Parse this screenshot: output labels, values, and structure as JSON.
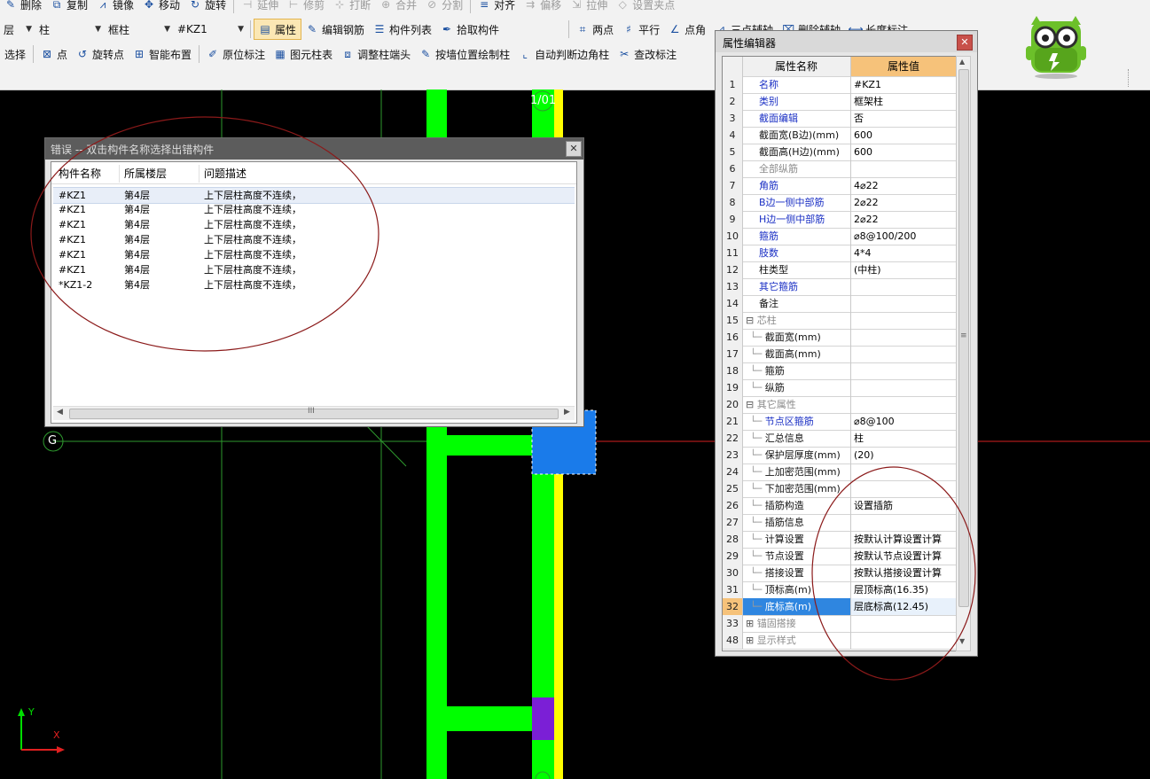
{
  "toolbar": {
    "row1": [
      {
        "label": "删除",
        "icon": "delete-icon",
        "dim": false
      },
      {
        "label": "复制",
        "icon": "copy-icon",
        "dim": false
      },
      {
        "label": "镜像",
        "icon": "mirror-icon",
        "dim": false
      },
      {
        "label": "移动",
        "icon": "move-icon",
        "dim": false
      },
      {
        "label": "旋转",
        "icon": "rotate-icon",
        "dim": false
      },
      {
        "label": "延伸",
        "icon": "extend-icon",
        "dim": true
      },
      {
        "label": "修剪",
        "icon": "trim-icon",
        "dim": true
      },
      {
        "label": "打断",
        "icon": "break-icon",
        "dim": true
      },
      {
        "label": "合并",
        "icon": "merge-icon",
        "dim": true
      },
      {
        "label": "分割",
        "icon": "split-icon",
        "dim": true
      },
      {
        "label": "对齐",
        "icon": "align-icon",
        "dim": false
      },
      {
        "label": "偏移",
        "icon": "offset-icon",
        "dim": true
      },
      {
        "label": "拉伸",
        "icon": "stretch-icon",
        "dim": true
      },
      {
        "label": "设置夹点",
        "icon": "grip-icon",
        "dim": true
      }
    ],
    "row2_selects": [
      "层",
      "柱",
      "框柱",
      "#KZ1"
    ],
    "row2_buttons": [
      {
        "label": "属性",
        "icon": "properties-icon",
        "active": true
      },
      {
        "label": "编辑钢筋",
        "icon": "edit-rebar-icon",
        "active": false
      },
      {
        "label": "构件列表",
        "icon": "component-list-icon",
        "active": false
      },
      {
        "label": "拾取构件",
        "icon": "pick-component-icon",
        "active": false
      }
    ],
    "row2_right": [
      {
        "label": "两点",
        "icon": "two-point-icon"
      },
      {
        "label": "平行",
        "icon": "parallel-icon"
      },
      {
        "label": "点角",
        "icon": "point-angle-icon"
      },
      {
        "label": "三点辅轴",
        "icon": "three-point-axis-icon"
      },
      {
        "label": "删除辅轴",
        "icon": "delete-axis-icon"
      },
      {
        "label": "长度标注",
        "icon": "length-dim-icon"
      }
    ],
    "row3": [
      {
        "label": "选择",
        "icon": "select-icon"
      },
      {
        "label": "点",
        "icon": "point-icon"
      },
      {
        "label": "旋转点",
        "icon": "rotate-point-icon"
      },
      {
        "label": "智能布置",
        "icon": "smart-layout-icon"
      },
      {
        "label": "原位标注",
        "icon": "in-place-mark-icon"
      },
      {
        "label": "图元柱表",
        "icon": "column-table-icon"
      },
      {
        "label": "调整柱端头",
        "icon": "adjust-column-end-icon"
      },
      {
        "label": "按墙位置绘制柱",
        "icon": "draw-by-wall-icon"
      },
      {
        "label": "自动判断边角柱",
        "icon": "auto-corner-icon"
      },
      {
        "label": "查改标注",
        "icon": "check-mark-icon"
      }
    ]
  },
  "canvas": {
    "axis_label_g": "G",
    "axis_label_top": "1/01",
    "ucs_y": "Y",
    "ucs_x": "X"
  },
  "error_dialog": {
    "title": "错误 -- 双击构件名称选择出错构件",
    "columns": [
      "构件名称",
      "所属楼层",
      "问题描述"
    ],
    "rows": [
      [
        "#KZ1",
        "第4层",
        "上下层柱高度不连续，"
      ],
      [
        "#KZ1",
        "第4层",
        "上下层柱高度不连续，"
      ],
      [
        "#KZ1",
        "第4层",
        "上下层柱高度不连续，"
      ],
      [
        "#KZ1",
        "第4层",
        "上下层柱高度不连续，"
      ],
      [
        "#KZ1",
        "第4层",
        "上下层柱高度不连续，"
      ],
      [
        "#KZ1",
        "第4层",
        "上下层柱高度不连续，"
      ],
      [
        "*KZ1-2",
        "第4层",
        "上下层柱高度不连续，"
      ]
    ],
    "scroll_grip": "III"
  },
  "property_editor": {
    "title": "属性编辑器",
    "header_name": "属性名称",
    "header_value": "属性值",
    "rows": [
      {
        "n": "1",
        "name": "名称",
        "value": "#KZ1",
        "color": "blue",
        "indent": 0
      },
      {
        "n": "2",
        "name": "类别",
        "value": "框架柱",
        "color": "blue",
        "indent": 0
      },
      {
        "n": "3",
        "name": "截面编辑",
        "value": "否",
        "color": "blue",
        "indent": 0
      },
      {
        "n": "4",
        "name": "截面宽(B边)(mm)",
        "value": "600",
        "color": "black",
        "indent": 0
      },
      {
        "n": "5",
        "name": "截面高(H边)(mm)",
        "value": "600",
        "color": "black",
        "indent": 0
      },
      {
        "n": "6",
        "name": "全部纵筋",
        "value": "",
        "color": "grey",
        "indent": 0
      },
      {
        "n": "7",
        "name": "角筋",
        "value": "4⌀22",
        "color": "blue",
        "indent": 0
      },
      {
        "n": "8",
        "name": "B边一侧中部筋",
        "value": "2⌀22",
        "color": "blue",
        "indent": 0
      },
      {
        "n": "9",
        "name": "H边一侧中部筋",
        "value": "2⌀22",
        "color": "blue",
        "indent": 0
      },
      {
        "n": "10",
        "name": "箍筋",
        "value": "⌀8@100/200",
        "color": "blue",
        "indent": 0
      },
      {
        "n": "11",
        "name": "肢数",
        "value": "4*4",
        "color": "blue",
        "indent": 0
      },
      {
        "n": "12",
        "name": "柱类型",
        "value": "(中柱)",
        "color": "black",
        "indent": 0
      },
      {
        "n": "13",
        "name": "其它箍筋",
        "value": "",
        "color": "blue",
        "indent": 0
      },
      {
        "n": "14",
        "name": "备注",
        "value": "",
        "color": "black",
        "indent": 0
      },
      {
        "n": "15",
        "name": "芯柱",
        "value": "",
        "color": "grey",
        "indent": 0,
        "group": "minus"
      },
      {
        "n": "16",
        "name": "截面宽(mm)",
        "value": "",
        "color": "black",
        "indent": 1
      },
      {
        "n": "17",
        "name": "截面高(mm)",
        "value": "",
        "color": "black",
        "indent": 1
      },
      {
        "n": "18",
        "name": "箍筋",
        "value": "",
        "color": "black",
        "indent": 1
      },
      {
        "n": "19",
        "name": "纵筋",
        "value": "",
        "color": "black",
        "indent": 1
      },
      {
        "n": "20",
        "name": "其它属性",
        "value": "",
        "color": "grey",
        "indent": 0,
        "group": "minus"
      },
      {
        "n": "21",
        "name": "节点区箍筋",
        "value": "⌀8@100",
        "color": "blue",
        "indent": 1
      },
      {
        "n": "22",
        "name": "汇总信息",
        "value": "柱",
        "color": "black",
        "indent": 1
      },
      {
        "n": "23",
        "name": "保护层厚度(mm)",
        "value": "(20)",
        "color": "black",
        "indent": 1
      },
      {
        "n": "24",
        "name": "上加密范围(mm)",
        "value": "",
        "color": "black",
        "indent": 1
      },
      {
        "n": "25",
        "name": "下加密范围(mm)",
        "value": "",
        "color": "black",
        "indent": 1
      },
      {
        "n": "26",
        "name": "插筋构造",
        "value": "设置插筋",
        "color": "black",
        "indent": 1
      },
      {
        "n": "27",
        "name": "插筋信息",
        "value": "",
        "color": "black",
        "indent": 1
      },
      {
        "n": "28",
        "name": "计算设置",
        "value": "按默认计算设置计算",
        "color": "black",
        "indent": 1
      },
      {
        "n": "29",
        "name": "节点设置",
        "value": "按默认节点设置计算",
        "color": "black",
        "indent": 1
      },
      {
        "n": "30",
        "name": "搭接设置",
        "value": "按默认搭接设置计算",
        "color": "black",
        "indent": 1
      },
      {
        "n": "31",
        "name": "顶标高(m)",
        "value": "层顶标高(16.35)",
        "color": "black",
        "indent": 1
      },
      {
        "n": "32",
        "name": "底标高(m)",
        "value": "层底标高(12.45)",
        "color": "black",
        "indent": 1,
        "selected": true
      },
      {
        "n": "33",
        "name": "锚固搭接",
        "value": "",
        "color": "grey",
        "indent": 0,
        "group": "plus"
      },
      {
        "n": "48",
        "name": "显示样式",
        "value": "",
        "color": "grey",
        "indent": 0,
        "group": "plus"
      }
    ]
  },
  "colors": {
    "toolbar_bg": "#f2f2f2",
    "canvas_bg": "#000000",
    "wall_green": "#00ff00",
    "wall_yellow": "#ffff00",
    "column_purple": "#7b1fd6",
    "selected_blue": "#1a7bea",
    "header_orange": "#f6c27a",
    "annotation_red": "#8b1a1a"
  }
}
